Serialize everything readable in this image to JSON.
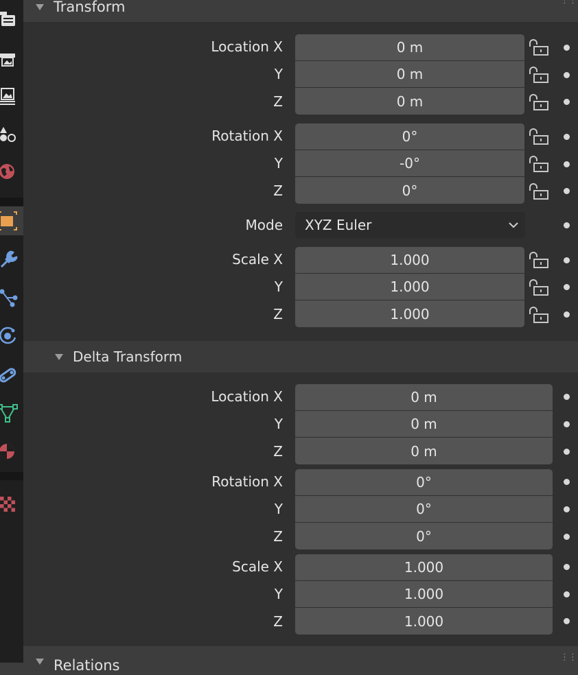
{
  "tabs": [
    {
      "name": "render-tab",
      "icon": "camera-back-icon",
      "active": false
    },
    {
      "name": "output-tab",
      "icon": "printer-icon",
      "active": false
    },
    {
      "name": "view-layer-tab",
      "icon": "image-stack-icon",
      "active": false
    },
    {
      "name": "scene-tab",
      "icon": "scene-icon",
      "active": false
    },
    {
      "name": "world-tab",
      "icon": "world-icon",
      "active": false
    },
    {
      "name": "object-tab",
      "icon": "object-square-icon",
      "active": true
    },
    {
      "name": "modifiers-tab",
      "icon": "wrench-icon",
      "active": false
    },
    {
      "name": "particles-tab",
      "icon": "particles-icon",
      "active": false
    },
    {
      "name": "physics-tab",
      "icon": "physics-orbit-icon",
      "active": false
    },
    {
      "name": "constraints-tab",
      "icon": "constraint-link-icon",
      "active": false
    },
    {
      "name": "data-tab",
      "icon": "mesh-triangle-icon",
      "active": false
    },
    {
      "name": "material-tab",
      "icon": "material-sphere-icon",
      "active": false
    },
    {
      "name": "texture-tab",
      "icon": "checker-texture-icon",
      "active": false
    }
  ],
  "transform": {
    "title": "Transform",
    "location_label": "Location X",
    "rotation_label": "Rotation X",
    "scale_label": "Scale X",
    "y_label": "Y",
    "z_label": "Z",
    "location": [
      "0 m",
      "0 m",
      "0 m"
    ],
    "rotation": [
      "0°",
      "-0°",
      "0°"
    ],
    "mode_label": "Mode",
    "mode_value": "XYZ Euler",
    "scale": [
      "1.000",
      "1.000",
      "1.000"
    ]
  },
  "delta": {
    "title": "Delta Transform",
    "location_label": "Location X",
    "rotation_label": "Rotation X",
    "scale_label": "Scale X",
    "y_label": "Y",
    "z_label": "Z",
    "location": [
      "0 m",
      "0 m",
      "0 m"
    ],
    "rotation": [
      "0°",
      "0°",
      "0°"
    ],
    "scale": [
      "1.000",
      "1.000",
      "1.000"
    ]
  },
  "relations": {
    "title": "Relations"
  },
  "colors": {
    "active_tab_icon": "#e8a050",
    "field": "#545454",
    "panel": "#303030"
  }
}
